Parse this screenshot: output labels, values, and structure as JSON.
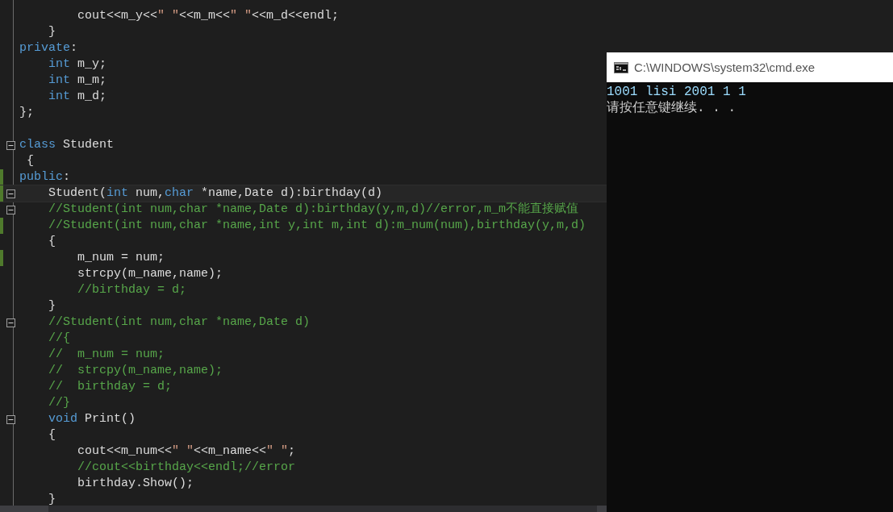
{
  "editor": {
    "lines": [
      {
        "kind": "body",
        "segments": [
          {
            "kind": "text",
            "text": "cout<<m_y<<"
          },
          {
            "kind": "string",
            "text": "\" \""
          },
          {
            "kind": "text",
            "text": "<<m_m<<"
          },
          {
            "kind": "string",
            "text": "\" \""
          },
          {
            "kind": "text",
            "text": "<<m_d<<endl;"
          }
        ]
      },
      {
        "kind": "member",
        "segments": [
          {
            "kind": "text",
            "text": "}"
          }
        ]
      },
      {
        "kind": "outer",
        "segments": [
          {
            "kind": "keyword",
            "text": "private"
          },
          {
            "kind": "text",
            "text": ":"
          }
        ]
      },
      {
        "kind": "member",
        "segments": [
          {
            "kind": "keyword",
            "text": "int"
          },
          {
            "kind": "text",
            "text": " m_y;"
          }
        ]
      },
      {
        "kind": "member",
        "segments": [
          {
            "kind": "keyword",
            "text": "int"
          },
          {
            "kind": "text",
            "text": " m_m;"
          }
        ]
      },
      {
        "kind": "member",
        "segments": [
          {
            "kind": "keyword",
            "text": "int"
          },
          {
            "kind": "text",
            "text": " m_d;"
          }
        ]
      },
      {
        "kind": "outer",
        "segments": [
          {
            "kind": "text",
            "text": "};"
          }
        ]
      },
      {
        "kind": "blank"
      },
      {
        "kind": "outer",
        "fold": true,
        "segments": [
          {
            "kind": "keyword",
            "text": "class"
          },
          {
            "kind": "text",
            "text": " Student"
          }
        ]
      },
      {
        "kind": "outer",
        "segments": [
          {
            "kind": "text",
            "text": " {"
          }
        ]
      },
      {
        "kind": "outer",
        "changed": true,
        "segments": [
          {
            "kind": "keyword",
            "text": "public"
          },
          {
            "kind": "text",
            "text": ":"
          }
        ]
      },
      {
        "kind": "member",
        "changed": true,
        "fold": true,
        "current": true,
        "segments": [
          {
            "kind": "text",
            "text": "Student("
          },
          {
            "kind": "keyword",
            "text": "int"
          },
          {
            "kind": "text",
            "text": " num,"
          },
          {
            "kind": "keyword",
            "text": "char"
          },
          {
            "kind": "text",
            "text": " *name,Date d):birthday(d)"
          }
        ]
      },
      {
        "kind": "member",
        "fold": true,
        "segments": [
          {
            "kind": "comment",
            "text": "//Student(int num,char *name,Date d):birthday(y,m,d)//error,m_m不能直接赋值"
          }
        ]
      },
      {
        "kind": "member",
        "changed": true,
        "segments": [
          {
            "kind": "comment",
            "text": "//Student(int num,char *name,int y,int m,int d):m_num(num),birthday(y,m,d)"
          }
        ]
      },
      {
        "kind": "member",
        "segments": [
          {
            "kind": "text",
            "text": "{"
          }
        ]
      },
      {
        "kind": "body",
        "changed": true,
        "segments": [
          {
            "kind": "text",
            "text": "m_num = num;"
          }
        ]
      },
      {
        "kind": "body",
        "segments": [
          {
            "kind": "text",
            "text": "strcpy(m_name,name);"
          }
        ]
      },
      {
        "kind": "body",
        "segments": [
          {
            "kind": "comment",
            "text": "//birthday = d;"
          }
        ]
      },
      {
        "kind": "member",
        "segments": [
          {
            "kind": "text",
            "text": "}"
          }
        ]
      },
      {
        "kind": "member",
        "fold": true,
        "segments": [
          {
            "kind": "comment",
            "text": "//Student(int num,char *name,Date d)"
          }
        ]
      },
      {
        "kind": "member",
        "segments": [
          {
            "kind": "comment",
            "text": "//{"
          }
        ]
      },
      {
        "kind": "member",
        "segments": [
          {
            "kind": "comment",
            "text": "//  m_num = num;"
          }
        ]
      },
      {
        "kind": "member",
        "segments": [
          {
            "kind": "comment",
            "text": "//  strcpy(m_name,name);"
          }
        ]
      },
      {
        "kind": "member",
        "segments": [
          {
            "kind": "comment",
            "text": "//  birthday = d;"
          }
        ]
      },
      {
        "kind": "member",
        "segments": [
          {
            "kind": "comment",
            "text": "//}"
          }
        ]
      },
      {
        "kind": "member",
        "fold": true,
        "segments": [
          {
            "kind": "keyword",
            "text": "void"
          },
          {
            "kind": "text",
            "text": " Print()"
          }
        ]
      },
      {
        "kind": "member",
        "segments": [
          {
            "kind": "text",
            "text": "{"
          }
        ]
      },
      {
        "kind": "body",
        "segments": [
          {
            "kind": "text",
            "text": "cout<<m_num<<"
          },
          {
            "kind": "string",
            "text": "\" \""
          },
          {
            "kind": "text",
            "text": "<<m_name<<"
          },
          {
            "kind": "string",
            "text": "\" \""
          },
          {
            "kind": "text",
            "text": ";"
          }
        ]
      },
      {
        "kind": "body",
        "segments": [
          {
            "kind": "comment",
            "text": "//cout<<birthday<<endl;//error"
          }
        ]
      },
      {
        "kind": "body",
        "segments": [
          {
            "kind": "text",
            "text": "birthday.Show();"
          }
        ]
      },
      {
        "kind": "member",
        "segments": [
          {
            "kind": "text",
            "text": "}"
          }
        ]
      }
    ]
  },
  "console": {
    "title": "C:\\WINDOWS\\system32\\cmd.exe",
    "lines": [
      "1001 lisi 2001 1 1",
      "请按任意键继续. . ."
    ]
  }
}
